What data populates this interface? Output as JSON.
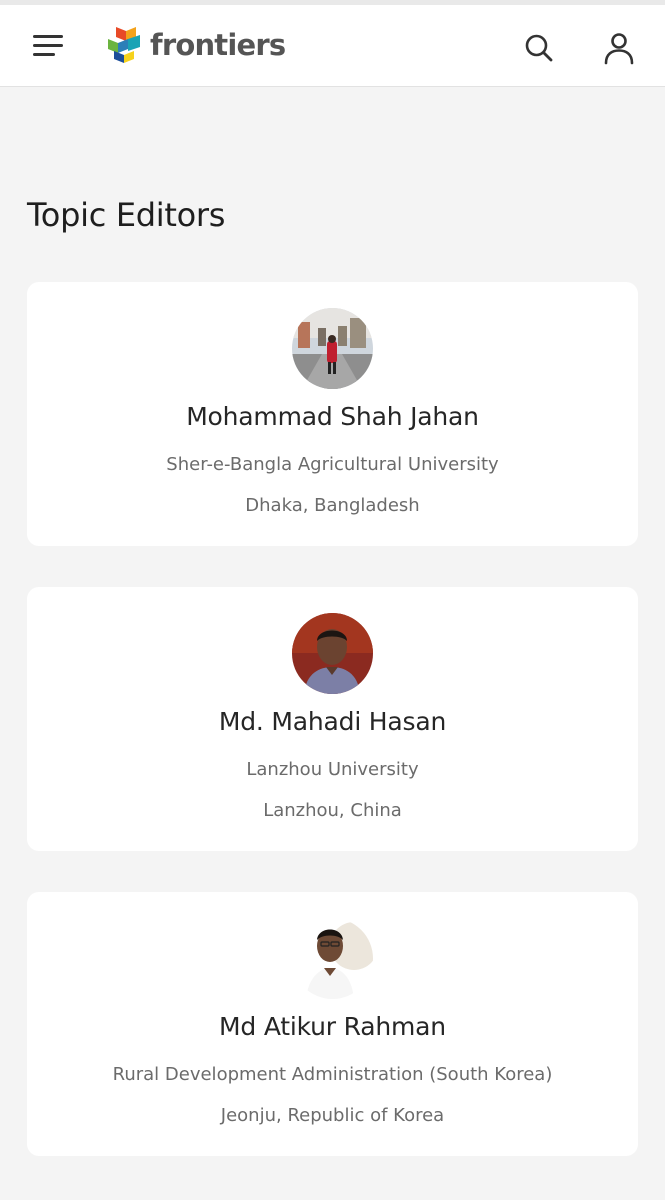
{
  "header": {
    "menu_icon": "hamburger-menu-icon",
    "logo_text": "frontiers",
    "search_icon": "search-icon",
    "account_icon": "user-account-icon"
  },
  "section": {
    "title": "Topic Editors"
  },
  "editors": [
    {
      "name": "Mohammad Shah Jahan",
      "affiliation": "Sher-e-Bangla Agricultural University",
      "location": "Dhaka, Bangladesh"
    },
    {
      "name": "Md. Mahadi Hasan",
      "affiliation": "Lanzhou University",
      "location": "Lanzhou, China"
    },
    {
      "name": "Md Atikur Rahman",
      "affiliation": "Rural Development Administration (South Korea)",
      "location": "Jeonju, Republic of Korea"
    }
  ],
  "colors": {
    "page_background": "#f4f4f4",
    "card_background": "#ffffff",
    "text_dark": "#262626",
    "text_muted": "#6b6b6b"
  }
}
